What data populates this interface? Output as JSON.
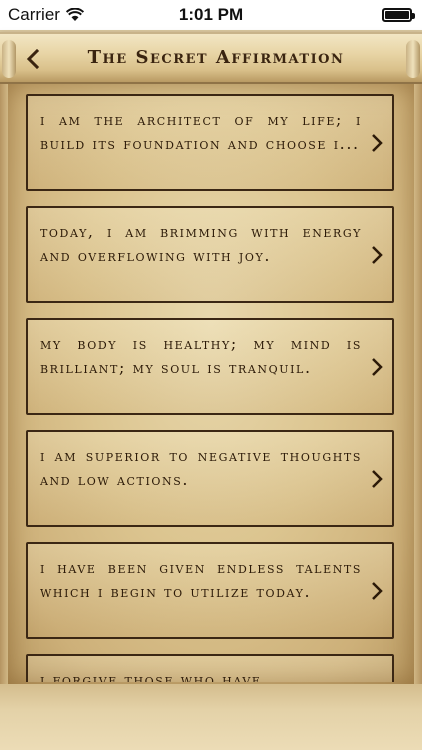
{
  "status_bar": {
    "carrier": "Carrier",
    "time": "1:01 PM",
    "battery_icon": "battery-full-icon",
    "wifi_icon": "wifi-icon"
  },
  "header": {
    "title": "The Secret Affirmation",
    "back_icon": "chevron-left-icon"
  },
  "affirmations": [
    {
      "text": "I am the architect of my life; I build its foundation and choose i..."
    },
    {
      "text": "Today, I am brimming with energy and overflowing with joy."
    },
    {
      "text": "My body is healthy; my mind is brilliant; my soul is tranquil."
    },
    {
      "text": "I am superior to negative thoughts and low actions."
    },
    {
      "text": "I have been given endless talents which I begin to utilize today."
    },
    {
      "text": "I forgive those who have"
    }
  ],
  "colors": {
    "ink": "#2c1a08",
    "parchment": "#dcc590",
    "border": "#3b2714"
  }
}
